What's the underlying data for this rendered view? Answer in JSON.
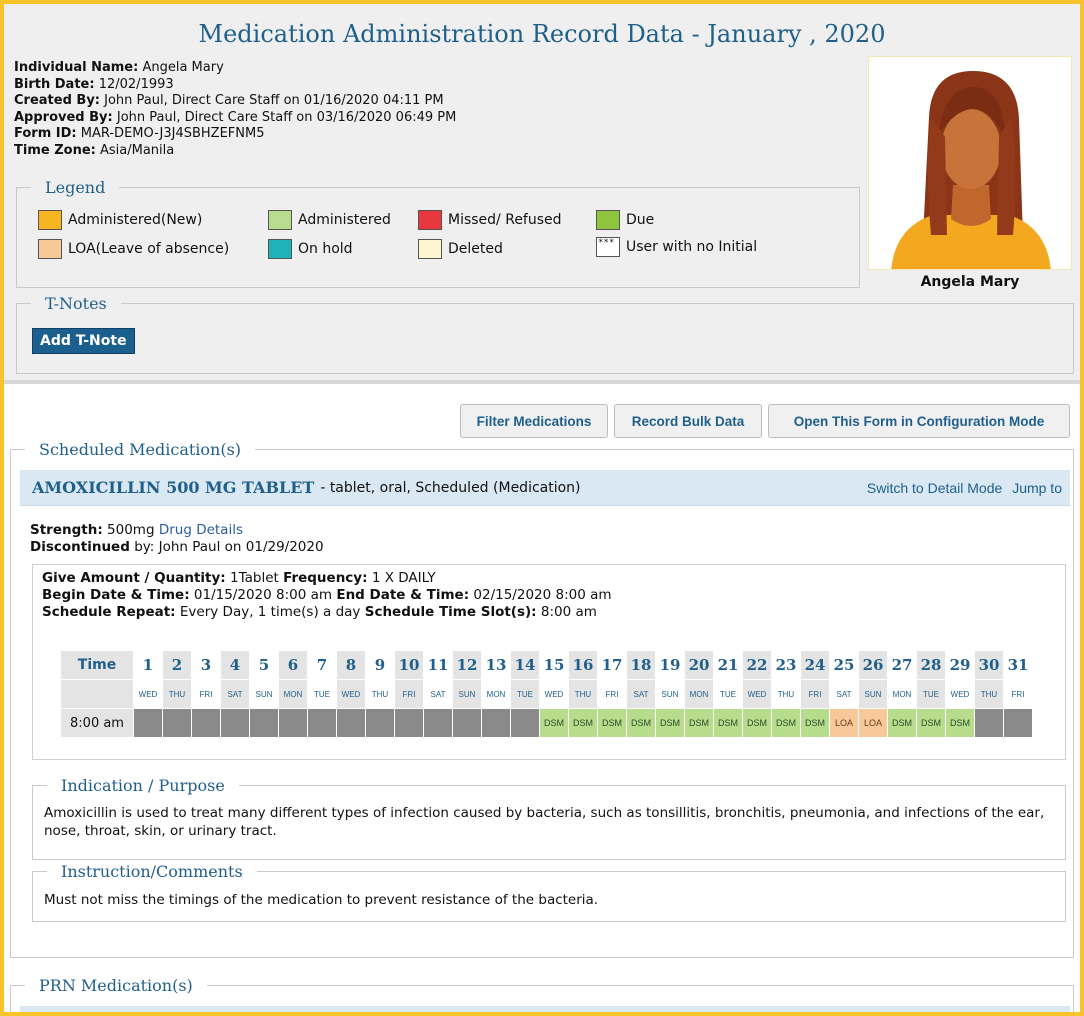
{
  "header": {
    "title": "Medication Administration Record Data - January , 2020",
    "individual_label": "Individual Name:",
    "individual_value": "Angela Mary",
    "birth_label": "Birth Date:",
    "birth_value": "12/02/1993",
    "created_label": "Created By:",
    "created_value": "John Paul, Direct Care Staff on 01/16/2020 04:11 PM",
    "approved_label": "Approved By:",
    "approved_value": "John Paul, Direct Care Staff on 03/16/2020 06:49 PM",
    "formid_label": "Form ID:",
    "formid_value": "MAR-DEMO-J3J4SBHZEFNM5",
    "timezone_label": "Time Zone:",
    "timezone_value": "Asia/Manila",
    "photo_name": "Angela Mary"
  },
  "legend": {
    "title": "Legend",
    "items": [
      {
        "label": "Administered(New)",
        "color": "#f6b521"
      },
      {
        "label": "Administered",
        "color": "#b9dc8e"
      },
      {
        "label": "Missed/ Refused",
        "color": "#e8383d"
      },
      {
        "label": "Due",
        "color": "#8fc43f"
      },
      {
        "label": "LOA(Leave of absence)",
        "color": "#f8c998"
      },
      {
        "label": "On hold",
        "color": "#20b3b9"
      },
      {
        "label": "Deleted",
        "color": "#fdf6d0"
      },
      {
        "label": "User with no Initial",
        "color": "#ffffff",
        "symbol": "***"
      }
    ]
  },
  "tnotes": {
    "title": "T-Notes",
    "add_label": "Add T-Note"
  },
  "toolbar": {
    "filter_label": "Filter Medications",
    "bulk_label": "Record Bulk Data",
    "config_label": "Open This Form in Configuration Mode"
  },
  "scheduled": {
    "title": "Scheduled Medication(s)",
    "med_name": "AMOXICILLIN 500 MG TABLET",
    "med_desc": "- tablet, oral, Scheduled (Medication)",
    "switch_label": "Switch to Detail Mode",
    "jump_label": "Jump to",
    "strength_label": "Strength:",
    "strength_value": "500mg",
    "drug_details_label": "Drug Details",
    "discontinued_label": "Discontinued",
    "discontinued_value": "by: John Paul on 01/29/2020",
    "give_label": "Give Amount / Quantity:",
    "give_value": "1Tablet",
    "freq_label": "Frequency:",
    "freq_value": "1 X DAILY",
    "begin_label": "Begin Date & Time:",
    "begin_value": "01/15/2020 8:00 am",
    "end_label": "End Date & Time:",
    "end_value": "02/15/2020 8:00 am",
    "repeat_label": "Schedule Repeat:",
    "repeat_value": "Every Day, 1 time(s) a day",
    "slot_label": "Schedule Time Slot(s):",
    "slot_value": "8:00 am",
    "grid": {
      "time_header": "Time",
      "slot_time": "8:00 am",
      "days": [
        "1",
        "2",
        "3",
        "4",
        "5",
        "6",
        "7",
        "8",
        "9",
        "10",
        "11",
        "12",
        "13",
        "14",
        "15",
        "16",
        "17",
        "18",
        "19",
        "20",
        "21",
        "22",
        "23",
        "24",
        "25",
        "26",
        "27",
        "28",
        "29",
        "30",
        "31"
      ],
      "dow": [
        "WED",
        "THU",
        "FRI",
        "SAT",
        "SUN",
        "MON",
        "TUE",
        "WED",
        "THU",
        "FRI",
        "SAT",
        "SUN",
        "MON",
        "TUE",
        "WED",
        "THU",
        "FRI",
        "SAT",
        "SUN",
        "MON",
        "TUE",
        "WED",
        "THU",
        "FRI",
        "SAT",
        "SUN",
        "MON",
        "TUE",
        "WED",
        "THU",
        "FRI"
      ],
      "cells": [
        "",
        "",
        "",
        "",
        "",
        "",
        "",
        "",
        "",
        "",
        "",
        "",
        "",
        "",
        "DSM",
        "DSM",
        "DSM",
        "DSM",
        "DSM",
        "DSM",
        "DSM",
        "DSM",
        "DSM",
        "DSM",
        "LOA",
        "LOA",
        "DSM",
        "DSM",
        "DSM",
        "",
        ""
      ],
      "cell_status": [
        "g",
        "g",
        "g",
        "g",
        "g",
        "g",
        "g",
        "g",
        "g",
        "g",
        "g",
        "g",
        "g",
        "g",
        "d",
        "d",
        "d",
        "d",
        "d",
        "d",
        "d",
        "d",
        "d",
        "d",
        "l",
        "l",
        "d",
        "d",
        "d",
        "g",
        "g"
      ]
    },
    "indication_title": "Indication / Purpose",
    "indication_text": "Amoxicillin is used to treat many different types of infection caused by bacteria, such as tonsillitis, bronchitis, pneumonia, and infections of the ear, nose, throat, skin, or urinary tract.",
    "instruction_title": "Instruction/Comments",
    "instruction_text": "Must not miss the timings of the medication to prevent resistance of the bacteria."
  },
  "prn": {
    "title": "PRN Medication(s)"
  }
}
